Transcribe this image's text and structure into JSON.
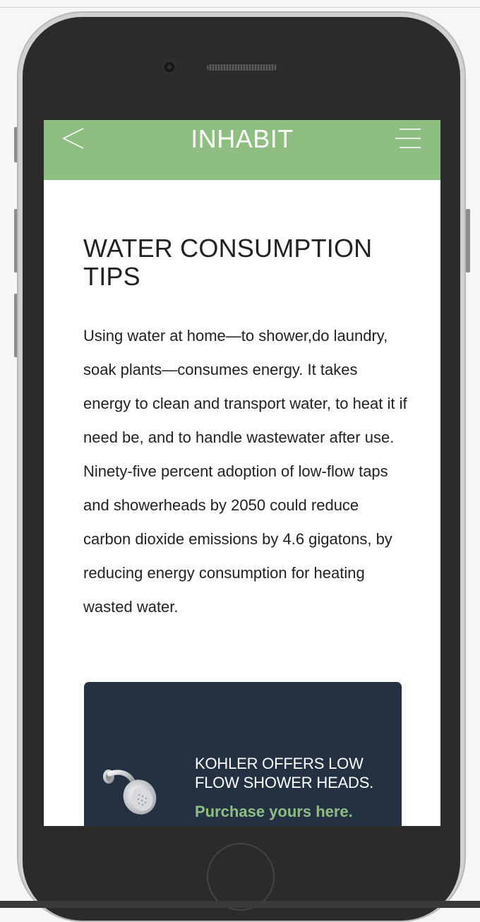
{
  "app": {
    "brand": "INHABIT"
  },
  "article": {
    "title": "WATER CONSUMPTION TIPS",
    "body": "Using water at home—to shower,do laundry, soak plants—consumes energy. It takes energy to clean and transport water, to heat it if need be, and to handle wastewater after use. Ninety-five percent adoption of low-flow taps and showerheads by 2050 could reduce carbon dioxide emissions by 4.6 gigatons, by reducing energy consumption for heating wasted water."
  },
  "promo": {
    "heading": "KOHLER OFFERS LOW FLOW SHOWER HEADS.",
    "link_label": "Purchase yours here.",
    "image": "shower-head-image"
  },
  "icons": {
    "back": "chevron-left-icon",
    "menu": "hamburger-menu-icon"
  },
  "colors": {
    "navbar": "#8fbe83",
    "accent_link": "#8fbe83",
    "card_bg": "#233142",
    "text": "#222222",
    "device_body": "#2b2b2b"
  }
}
